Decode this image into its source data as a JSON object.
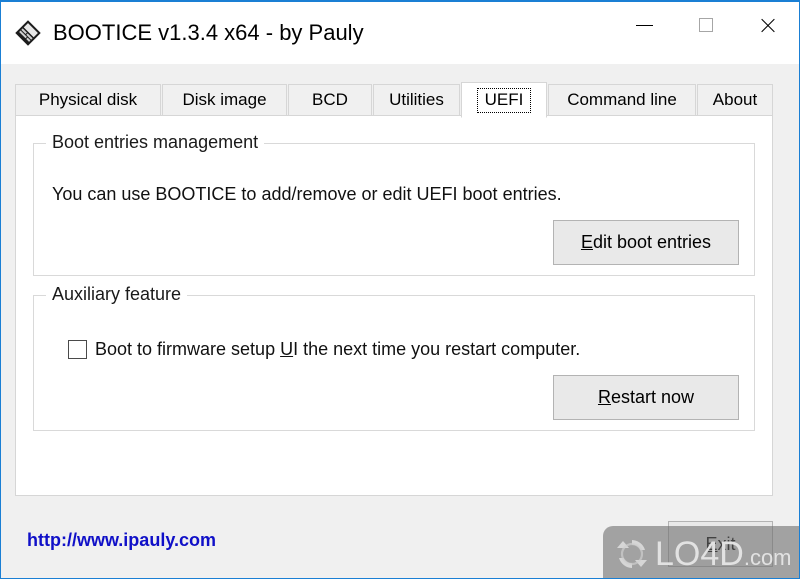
{
  "window": {
    "title": "BOOTICE v1.3.4 x64 - by Pauly",
    "icon": "app-diamond-icon",
    "border_color": "#1a7fd4",
    "caption": {
      "minimize": "minimize-icon",
      "maximize": "maximize-icon",
      "close": "close-icon"
    }
  },
  "tabs": [
    {
      "label": "Physical disk",
      "selected": false
    },
    {
      "label": "Disk  image",
      "selected": false
    },
    {
      "label": "BCD",
      "selected": false
    },
    {
      "label": "Utilities",
      "selected": false
    },
    {
      "label": "UEFI",
      "selected": true
    },
    {
      "label": "Command line",
      "selected": false
    },
    {
      "label": "About",
      "selected": false
    }
  ],
  "uefi_page": {
    "boot_entries_group": {
      "title": "Boot entries management",
      "description": "You can use BOOTICE to add/remove or edit UEFI boot entries.",
      "button": {
        "accel": "E",
        "rest": "dit boot entries",
        "full_label": "Edit boot entries"
      }
    },
    "auxiliary_group": {
      "title": "Auxiliary feature",
      "checkbox": {
        "checked": false,
        "text_before": "Boot to firmware setup ",
        "accel": "U",
        "text_after": "I the next time you restart computer.",
        "full_label": "Boot to firmware setup UI the next time you restart computer."
      },
      "button": {
        "accel": "R",
        "rest": "estart now",
        "full_label": "Restart now"
      }
    }
  },
  "footer": {
    "link": "http://www.ipauly.com",
    "link_color": "#1010c8",
    "exit_button": {
      "accel": "E",
      "rest": "xit",
      "full_label": "Exit"
    }
  },
  "watermark": {
    "brand": "LO4D",
    "suffix": ".com",
    "icon": "refresh-circular-arrows-icon"
  }
}
